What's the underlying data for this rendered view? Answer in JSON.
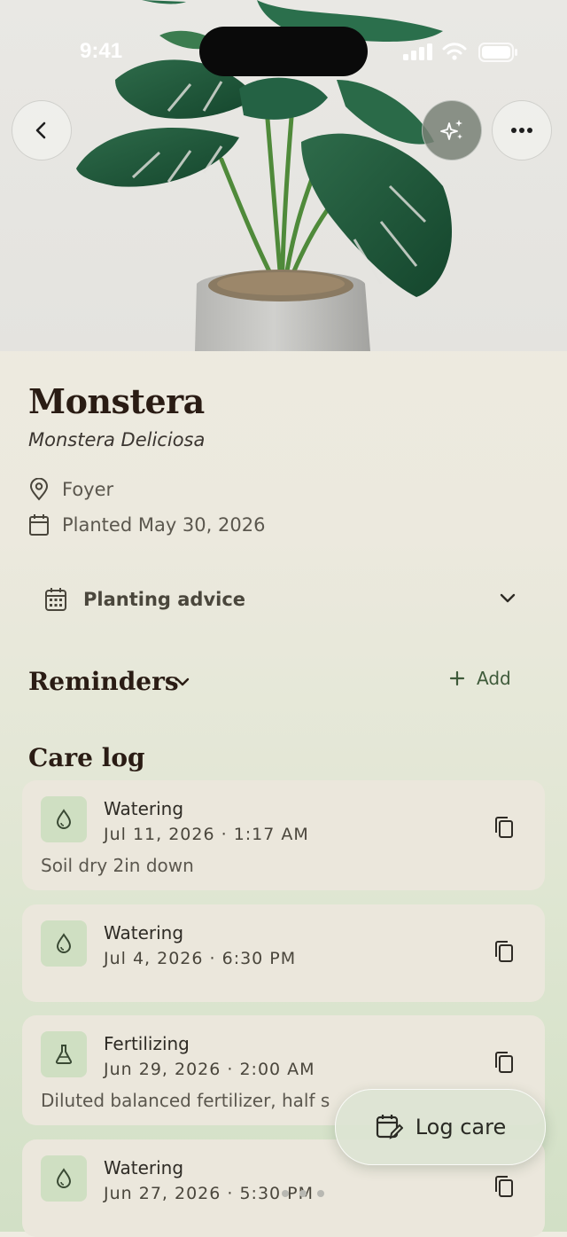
{
  "status_bar": {
    "time": "9:41"
  },
  "plant": {
    "name": "Monstera",
    "scientific_name": "Monstera Deliciosa",
    "location": "Foyer",
    "planted": "Planted May 30, 2026"
  },
  "icons": {
    "back": "chevron-left-icon",
    "ai": "sparkles-icon",
    "more": "more-horizontal-icon",
    "location": "map-pin-icon",
    "calendar": "calendar-icon",
    "advice": "calendar-grid-icon",
    "water": "water-drop-icon",
    "fertilize": "flask-icon",
    "copy": "copy-icon",
    "log": "calendar-edit-icon"
  },
  "planting_advice": {
    "label": "Planting advice"
  },
  "reminders": {
    "title": "Reminders",
    "add_label": "Add"
  },
  "care_log": {
    "title": "Care log",
    "entries": [
      {
        "type": "Watering",
        "datetime": "Jul 11, 2026 · 1:17 AM",
        "note": "Soil dry 2in down",
        "icon": "water-drop-icon"
      },
      {
        "type": "Watering",
        "datetime": "Jul 4, 2026 · 6:30 PM",
        "note": "",
        "icon": "water-drop-icon"
      },
      {
        "type": "Fertilizing",
        "datetime": "Jun 29, 2026 · 2:00 AM",
        "note": "Diluted balanced fertilizer, half s",
        "icon": "flask-icon"
      },
      {
        "type": "Watering",
        "datetime": "Jun 27, 2026 · 5:30 PM",
        "note": "",
        "icon": "water-drop-icon"
      }
    ]
  },
  "fab": {
    "label": "Log care"
  },
  "colors": {
    "accent": "#3e5a3a",
    "icon_bg": "#cfdfc2",
    "card_bg": "#ebe7dc",
    "title": "#2a1c14"
  }
}
